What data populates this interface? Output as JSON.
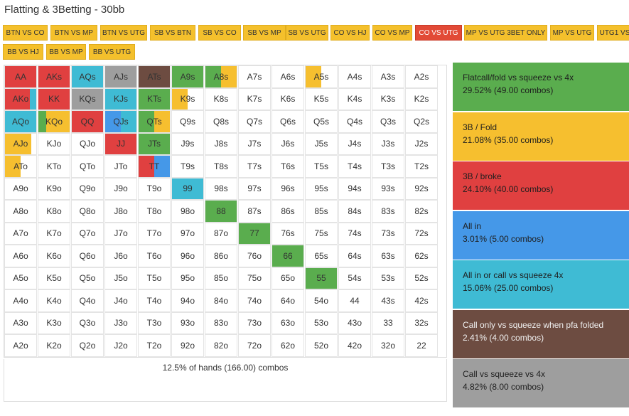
{
  "title": "Flatting & 3Betting - 30bb",
  "colors": {
    "green": "#5aad4e",
    "yellow": "#f6bf2f",
    "red": "#e04040",
    "blue": "#4598e8",
    "cyan": "#3fbbd4",
    "brown": "#6d4c41",
    "gray": "#9e9e9e",
    "tab": "#f4c02c",
    "tab_active": "#e24a36"
  },
  "tabs": [
    {
      "label": "BTN VS CO"
    },
    {
      "label": "BTN VS MP"
    },
    {
      "label": "BTN VS UTG"
    },
    {
      "label": "SB VS BTN"
    },
    {
      "label": "SB VS CO"
    },
    {
      "label": "SB VS MP"
    },
    {
      "label": "SB VS UTG"
    },
    {
      "label": "CO VS HJ"
    },
    {
      "label": "CO VS MP"
    },
    {
      "label": "CO VS UTG",
      "active": true
    },
    {
      "label": "MP VS UTG 3BET ONLY"
    },
    {
      "label": "MP VS UTG"
    },
    {
      "label": "UTG1 VS"
    },
    {
      "label": "BB VS HJ"
    },
    {
      "label": "BB VS MP"
    },
    {
      "label": "BB VS UTG"
    }
  ],
  "grid": [
    [
      "AA",
      "AKs",
      "AQs",
      "AJs",
      "ATs",
      "A9s",
      "A8s",
      "A7s",
      "A6s",
      "A5s",
      "A4s",
      "A3s",
      "A2s"
    ],
    [
      "AKo",
      "KK",
      "KQs",
      "KJs",
      "KTs",
      "K9s",
      "K8s",
      "K7s",
      "K6s",
      "K5s",
      "K4s",
      "K3s",
      "K2s"
    ],
    [
      "AQo",
      "KQo",
      "QQ",
      "QJs",
      "QTs",
      "Q9s",
      "Q8s",
      "Q7s",
      "Q6s",
      "Q5s",
      "Q4s",
      "Q3s",
      "Q2s"
    ],
    [
      "AJo",
      "KJo",
      "QJo",
      "JJ",
      "JTs",
      "J9s",
      "J8s",
      "J7s",
      "J6s",
      "J5s",
      "J4s",
      "J3s",
      "J2s"
    ],
    [
      "ATo",
      "KTo",
      "QTo",
      "JTo",
      "TT",
      "T9s",
      "T8s",
      "T7s",
      "T6s",
      "T5s",
      "T4s",
      "T3s",
      "T2s"
    ],
    [
      "A9o",
      "K9o",
      "Q9o",
      "J9o",
      "T9o",
      "99",
      "98s",
      "97s",
      "96s",
      "95s",
      "94s",
      "93s",
      "92s"
    ],
    [
      "A8o",
      "K8o",
      "Q8o",
      "J8o",
      "T8o",
      "98o",
      "88",
      "87s",
      "86s",
      "85s",
      "84s",
      "83s",
      "82s"
    ],
    [
      "A7o",
      "K7o",
      "Q7o",
      "J7o",
      "T7o",
      "97o",
      "87o",
      "77",
      "76s",
      "75s",
      "74s",
      "73s",
      "72s"
    ],
    [
      "A6o",
      "K6o",
      "Q6o",
      "J6o",
      "T6o",
      "96o",
      "86o",
      "76o",
      "66",
      "65s",
      "64s",
      "63s",
      "62s"
    ],
    [
      "A5o",
      "K5o",
      "Q5o",
      "J5o",
      "T5o",
      "95o",
      "85o",
      "75o",
      "65o",
      "55",
      "54s",
      "53s",
      "52s"
    ],
    [
      "A4o",
      "K4o",
      "Q4o",
      "J4o",
      "T4o",
      "94o",
      "84o",
      "74o",
      "64o",
      "54o",
      "44",
      "43s",
      "42s"
    ],
    [
      "A3o",
      "K3o",
      "Q3o",
      "J3o",
      "T3o",
      "93o",
      "83o",
      "73o",
      "63o",
      "53o",
      "43o",
      "33",
      "32s"
    ],
    [
      "A2o",
      "K2o",
      "Q2o",
      "J2o",
      "T2o",
      "92o",
      "82o",
      "72o",
      "62o",
      "52o",
      "42o",
      "32o",
      "22"
    ]
  ],
  "fills": {
    "AA": [
      [
        "red",
        1
      ]
    ],
    "AKs": [
      [
        "red",
        1
      ]
    ],
    "AQs": [
      [
        "cyan",
        1
      ]
    ],
    "AJs": [
      [
        "gray",
        1
      ]
    ],
    "ATs": [
      [
        "brown",
        1
      ]
    ],
    "A9s": [
      [
        "green",
        1
      ]
    ],
    "A8s": [
      [
        "green",
        0.5
      ],
      [
        "yellow",
        0.5
      ]
    ],
    "A5s": [
      [
        "yellow",
        0.5
      ]
    ],
    "AKo": [
      [
        "red",
        0.8
      ],
      [
        "cyan",
        0.2
      ]
    ],
    "KK": [
      [
        "red",
        1
      ]
    ],
    "KQs": [
      [
        "gray",
        1
      ]
    ],
    "KJs": [
      [
        "cyan",
        1
      ]
    ],
    "KTs": [
      [
        "green",
        1
      ]
    ],
    "K9s": [
      [
        "yellow",
        0.5
      ]
    ],
    "AQo": [
      [
        "cyan",
        1
      ]
    ],
    "KQo": [
      [
        "green",
        0.25
      ],
      [
        "yellow",
        0.75
      ]
    ],
    "QQ": [
      [
        "red",
        1
      ]
    ],
    "QJs": [
      [
        "blue",
        0.5
      ],
      [
        "cyan",
        0.5
      ]
    ],
    "QTs": [
      [
        "green",
        0.5
      ],
      [
        "yellow",
        0.5
      ]
    ],
    "AJo": [
      [
        "yellow",
        0.85
      ]
    ],
    "JJ": [
      [
        "red",
        1
      ]
    ],
    "JTs": [
      [
        "green",
        1
      ]
    ],
    "ATo": [
      [
        "yellow",
        0.5
      ]
    ],
    "TT": [
      [
        "red",
        0.5
      ],
      [
        "blue",
        0.5
      ]
    ],
    "99": [
      [
        "cyan",
        1
      ]
    ],
    "88": [
      [
        "green",
        1
      ]
    ],
    "77": [
      [
        "green",
        1
      ]
    ],
    "66": [
      [
        "green",
        1
      ]
    ],
    "55": [
      [
        "green",
        1
      ]
    ]
  },
  "summary": "12.5% of hands (166.00) combos",
  "legend": [
    {
      "label": "Flatcall/fold vs squeeze vs 4x",
      "stats": "29.52% (49.00 combos)",
      "color": "green",
      "text": "#1e1e1e"
    },
    {
      "label": "3B / Fold",
      "stats": "21.08% (35.00 combos)",
      "color": "yellow",
      "text": "#1e1e1e"
    },
    {
      "label": "3B / broke",
      "stats": "24.10% (40.00 combos)",
      "color": "red",
      "text": "#1e1e1e"
    },
    {
      "label": "All in",
      "stats": "3.01% (5.00 combos)",
      "color": "blue",
      "text": "#1e1e1e"
    },
    {
      "label": "All in or call vs squeeze 4x",
      "stats": "15.06% (25.00 combos)",
      "color": "cyan",
      "text": "#1e1e1e"
    },
    {
      "label": "Call only vs squeeze when pfa folded",
      "stats": "2.41% (4.00 combos)",
      "color": "brown",
      "text": "#f0f0f0"
    },
    {
      "label": "Call vs squeeze vs 4x",
      "stats": "4.82% (8.00 combos)",
      "color": "gray",
      "text": "#1e1e1e"
    }
  ]
}
